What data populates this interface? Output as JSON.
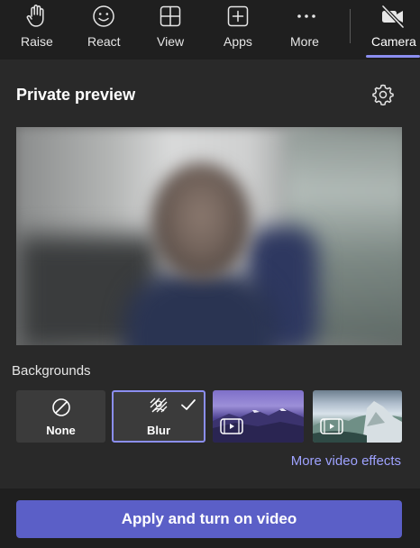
{
  "toolbar": {
    "raise_label": "Raise",
    "react_label": "React",
    "view_label": "View",
    "apps_label": "Apps",
    "more_label": "More",
    "camera_label": "Camera",
    "active_color": "#8b8ef0"
  },
  "panel": {
    "title": "Private preview",
    "backgrounds_label": "Backgrounds",
    "options": [
      {
        "label": "None",
        "icon": "no-symbol-icon",
        "selected": false
      },
      {
        "label": "Blur",
        "icon": "blur-icon",
        "selected": true
      },
      {
        "label": "",
        "icon": "video-background-icon",
        "selected": false
      },
      {
        "label": "",
        "icon": "video-background-icon",
        "selected": false
      }
    ],
    "more_effects_label": "More video effects"
  },
  "apply_button": {
    "label": "Apply and turn on video",
    "color": "#5b5fc7"
  }
}
